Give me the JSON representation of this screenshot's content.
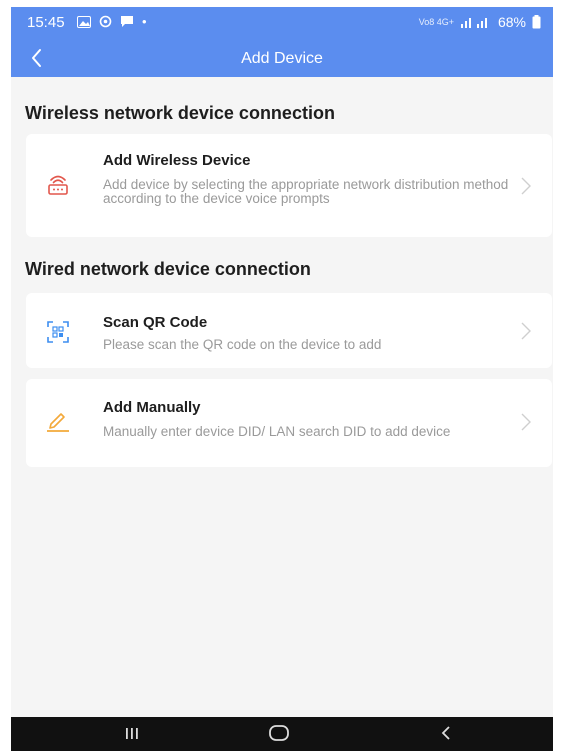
{
  "status_bar": {
    "time": "15:45",
    "left_icons": [
      "gallery-icon",
      "sync-icon",
      "message-icon"
    ],
    "dot": "•",
    "network_label": "Vo8 4G+",
    "battery": "68%"
  },
  "header": {
    "title": "Add Device"
  },
  "sections": [
    {
      "title": "Wireless network device connection",
      "items": [
        {
          "icon": "router-icon",
          "title": "Add Wireless Device",
          "description": "Add device by selecting the appropriate network distribution method according to the device voice prompts"
        }
      ]
    },
    {
      "title": "Wired network device connection",
      "items": [
        {
          "icon": "qr-scan-icon",
          "title": "Scan QR Code",
          "description": "Please scan the QR code on the device to add"
        },
        {
          "icon": "pencil-icon",
          "title": "Add Manually",
          "description": "Manually enter device DID/ LAN search DID to add device"
        }
      ]
    }
  ],
  "colors": {
    "accent": "#5b8def",
    "background": "#f5f5f5",
    "card": "#ffffff",
    "router_icon": "#e2574c",
    "qr_icon": "#3d8ef0",
    "pencil_icon": "#f3a93a"
  }
}
